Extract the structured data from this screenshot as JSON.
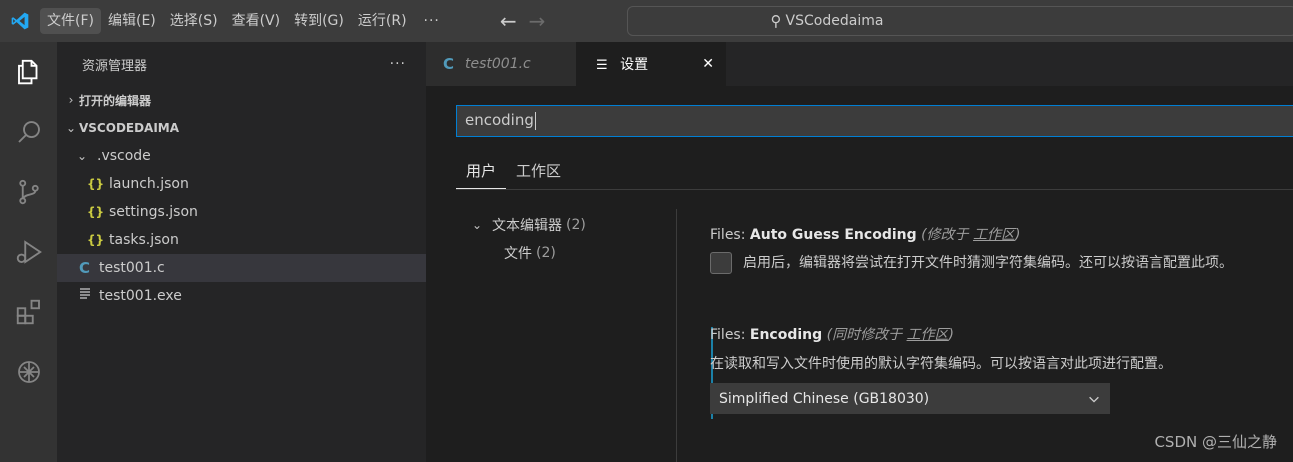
{
  "titlebar": {
    "menu": [
      "文件(F)",
      "编辑(E)",
      "选择(S)",
      "查看(V)",
      "转到(G)",
      "运行(R)"
    ],
    "more": "···",
    "command_center": "VSCodedaima"
  },
  "activitybar": {
    "icons": [
      "explorer-icon",
      "search-icon",
      "source-control-icon",
      "run-debug-icon",
      "extensions-icon",
      "chatgpt-icon"
    ]
  },
  "sidebar": {
    "title": "资源管理器",
    "more": "···",
    "open_editors": "打开的编辑器",
    "folder": "VSCODEDAIMA",
    "subfolder": ".vscode",
    "files": {
      "launch": "launch.json",
      "settings": "settings.json",
      "tasks": "tasks.json",
      "c_file": "test001.c",
      "exe_file": "test001.exe"
    },
    "json_glyph": "{}",
    "c_glyph": "C"
  },
  "tabs": {
    "file_tab": "test001.c",
    "settings_tab": "设置",
    "close": "✕"
  },
  "settings": {
    "search_value": "encoding",
    "scope_tabs": [
      "用户",
      "工作区"
    ],
    "toc": {
      "text_editor": "文本编辑器",
      "text_editor_count": "(2)",
      "files": "文件",
      "files_count": "(2)"
    },
    "auto_guess": {
      "prefix": "Files: ",
      "name": "Auto Guess Encoding",
      "modified_open": " (修改于 ",
      "modified_link": "工作区",
      "modified_close": ")",
      "description": "启用后，编辑器将尝试在打开文件时猜测字符集编码。还可以按语言配置此项。",
      "checked": false
    },
    "encoding": {
      "prefix": "Files: ",
      "name": "Encoding",
      "modified_open": " (同时修改于 ",
      "modified_link": "工作区",
      "modified_close": ")",
      "description": "在读取和写入文件时使用的默认字符集编码。可以按语言对此项进行配置。",
      "value": "Simplified Chinese (GB18030)"
    }
  },
  "watermark": "CSDN @三仙之静",
  "colors": {
    "accent": "#007fd4",
    "json": "#cbcb41",
    "c_file": "#519aba",
    "modified_bar": "#1b81a8"
  }
}
